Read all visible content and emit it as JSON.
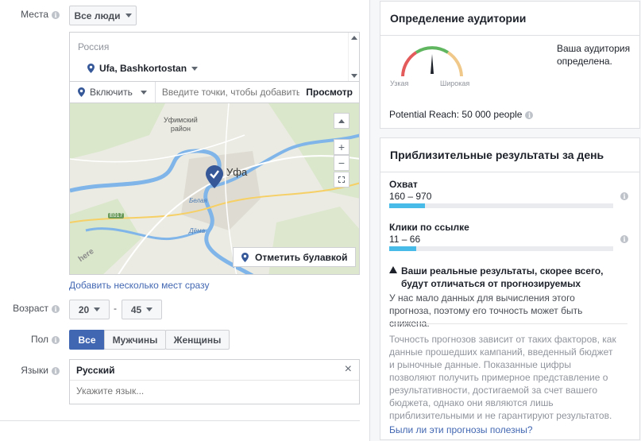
{
  "places": {
    "label": "Места",
    "dropdown": "Все люди",
    "country": "Россия",
    "city": "Ufa, Bashkortostan",
    "include": "Включить",
    "points_placeholder": "Введите точки, чтобы добавить их",
    "view": "Просмотр",
    "map_labels": {
      "district": "Уфимский\nрайон",
      "city": "Уфа",
      "river1": "Белая",
      "river2": "Дёма",
      "road": "E017",
      "here": "here"
    },
    "pin_button": "Отметить булавкой",
    "bulk_link": "Добавить несколько мест сразу"
  },
  "age": {
    "label": "Возраст",
    "from": "20",
    "sep": "-",
    "to": "45"
  },
  "gender": {
    "label": "Пол",
    "options": [
      "Все",
      "Мужчины",
      "Женщины"
    ],
    "selected": "Все"
  },
  "languages": {
    "label": "Языки",
    "selected": "Русский",
    "placeholder": "Укажите язык..."
  },
  "audience": {
    "title": "Определение аудитории",
    "narrow": "Узкая",
    "wide": "Широкая",
    "status": "Ваша аудитория определена.",
    "reach": "Potential Reach: 50 000 people",
    "gauge_value": 0.5
  },
  "daily": {
    "title": "Приблизительные результаты за день",
    "reach_label": "Охват",
    "reach_value": "160 – 970",
    "reach_fill": 0.16,
    "clicks_label": "Клики по ссылке",
    "clicks_value": "11 – 66",
    "clicks_fill": 0.12,
    "warning_title": "Ваши реальные результаты, скорее всего, будут отличаться от прогнозируемых",
    "warning_text": "У нас мало данных для вычисления этого прогноза, поэтому его точность может быть снижена.",
    "disclaimer": "Точность прогнозов зависит от таких факторов, как данные прошедших кампаний, введенный бюджет и рыночные данные. Показанные цифры позволяют получить примерное представление о результативности, достигаемой за счет вашего бюджета, однако они являются лишь приблизительными и не гарантируют результатов.",
    "feedback": "Были ли эти прогнозы полезны?"
  },
  "colors": {
    "accent": "#4267b2",
    "pin": "#365899",
    "bar": "#48bbe8"
  }
}
